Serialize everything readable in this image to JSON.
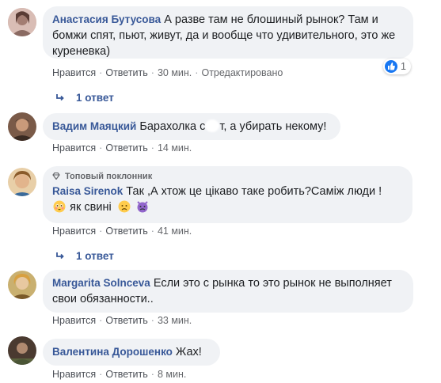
{
  "comments": [
    {
      "author": "Анастасия Бутусова",
      "text": "А разве там не блошиный рынок? Там и бомжи спят, пьют, живут, да и вообще что удивительного, это же куреневка)",
      "like": "Нравится",
      "reply": "Ответить",
      "time": "30 мин.",
      "edited": "Отредактировано",
      "reaction_count": "1",
      "replies": "1 ответ",
      "avatar_color": "#c9a9a3"
    },
    {
      "author": "Вадим Маяцкий",
      "text_part1": "Барахолка с",
      "text_part2": "т, а убирать некому!",
      "like": "Нравится",
      "reply": "Ответить",
      "time": "14 мин.",
      "avatar_color": "#6b4a3a"
    },
    {
      "badge": "Топовый поклонник",
      "author": "Raisa Sirenok",
      "text": "Так ,А хтож це цікаво таке робить?Саміж люди !",
      "text2": "як свині",
      "like": "Нравится",
      "reply": "Ответить",
      "time": "41 мин.",
      "replies": "1 ответ",
      "avatar_color": "#d8b48a"
    },
    {
      "author": "Margarita Solnceva",
      "text": "Если это с рынка то это рынок не выполняет свои обязанности..",
      "like": "Нравится",
      "reply": "Ответить",
      "time": "33 мин.",
      "avatar_color": "#b59a5a"
    },
    {
      "author": "Валентина Дорошенко",
      "text": "Жах!",
      "like": "Нравится",
      "reply": "Ответить",
      "time": "8 мин.",
      "avatar_color": "#5a4a40"
    }
  ],
  "colors": {
    "link": "#385898",
    "bubble": "#f0f2f5",
    "meta": "#65676b",
    "like_blue": "#1877f2"
  },
  "icons": {
    "reaction": "like-icon",
    "badge": "diamond-icon",
    "reply_arrow": "reply-arrow-icon"
  }
}
